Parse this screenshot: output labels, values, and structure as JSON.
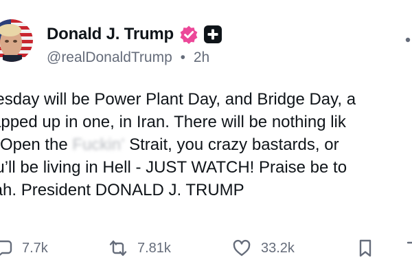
{
  "author": {
    "display_name": "Donald J. Trump",
    "handle": "@realDonaldTrump",
    "separator": "•",
    "time_ago": "2h",
    "avatar_icon": "flag-portrait-avatar",
    "verified_icon": "verified-badge-icon",
    "verified_color": "#ec4899",
    "app_badge_icon": "plus-square-icon"
  },
  "post": {
    "lines": [
      "uesday will be Power Plant Day, and Bridge Day, a",
      "rapped up in one, in Iran. There will be nothing lik",
      "!! Open the ",
      " Strait, you crazy bastards, or",
      "ou’ll be living in Hell - JUST WATCH! Praise be to",
      "llah. President DONALD J. TRUMP"
    ],
    "blurred_word": "Fuckin’"
  },
  "actions": {
    "reply_count": "7.7k",
    "repost_count": "7.81k",
    "like_count": "33.2k"
  },
  "colors": {
    "text": "#0f1419",
    "secondary": "#656c7a",
    "background": "#ffffff"
  }
}
